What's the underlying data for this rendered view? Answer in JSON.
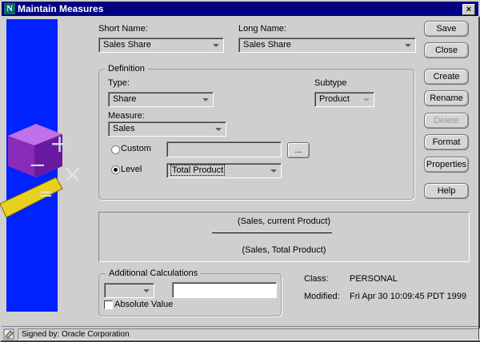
{
  "window": {
    "title": "Maintain Measures",
    "app_icon": "N",
    "close": "×"
  },
  "short_name": {
    "label": "Short Name:",
    "value": "Sales Share"
  },
  "long_name": {
    "label": "Long Name:",
    "value": "Sales Share"
  },
  "buttons": {
    "save": "Save",
    "close": "Close",
    "create": "Create",
    "rename": "Rename",
    "delete": "Delete",
    "format": "Format",
    "properties": "Properties",
    "help": "Help"
  },
  "definition": {
    "title": "Definition",
    "type_label": "Type:",
    "type_value": "Share",
    "subtype_label": "Subtype",
    "subtype_value": "Product",
    "measure_label": "Measure:",
    "measure_value": "Sales",
    "custom_label": "Custom",
    "custom_value": "",
    "browse": "...",
    "level_label": "Level",
    "level_value": "Total Product",
    "selected": "Level"
  },
  "formula": {
    "numerator": "(Sales, current Product)",
    "denominator": "(Sales, Total Product)"
  },
  "additional": {
    "title": "Additional Calculations",
    "select_value": "",
    "input_value": "",
    "absolute_label": "Absolute Value",
    "absolute_checked": false
  },
  "info": {
    "class_label": "Class:",
    "class_value": "PERSONAL",
    "modified_label": "Modified:",
    "modified_value": "Fri Apr 30 10:09:45 PDT 1999"
  },
  "status": {
    "text": "Signed by: Oracle Corporation"
  }
}
